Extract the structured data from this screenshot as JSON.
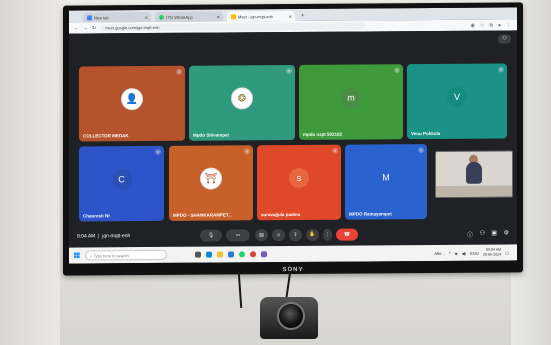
{
  "browser": {
    "tabs": [
      {
        "label": "New tab",
        "icon_color": "#4285f4"
      },
      {
        "label": "(75) WhatsApp",
        "icon_color": "#25d366"
      },
      {
        "label": "Meet - jqn-mqtt-enh",
        "icon_color": "#fbbc04"
      }
    ],
    "url": "meet.google.com/jqn-mqtt-enh"
  },
  "meet": {
    "tiles": [
      {
        "name": "COLLECTOR MEDAK",
        "bg": "#b5532c",
        "initial": ""
      },
      {
        "name": "Mpdo Shivampet",
        "bg": "#2f9a7e",
        "initial": ""
      },
      {
        "name": "mpdo nzpt 502102",
        "bg": "#3e9a3a",
        "initial": "m"
      },
      {
        "name": "Venu Pokkula",
        "bg": "#1a9386",
        "initial": "V"
      },
      {
        "name": "Chauresh Nr",
        "bg": "#2d55c9",
        "initial": "C"
      },
      {
        "name": "MPDO - SHANKARAMPET...",
        "bg": "#c8602a",
        "initial": ""
      },
      {
        "name": "suravajjula padma",
        "bg": "#e0482a",
        "initial": "s"
      },
      {
        "name": "MPDO Ramayampet",
        "bg": "#2a62cf",
        "initial": "M"
      }
    ],
    "time": "9:04 AM",
    "meeting_code": "jqn-mqtt-enh"
  },
  "taskbar": {
    "search_placeholder": "Type here to search",
    "weather": "Afte...",
    "lang": "ENG",
    "time": "09:04 AM",
    "date": "20-06-2024"
  },
  "brand": "SONY",
  "colors": {
    "end_call": "#ea4335",
    "meet_bg": "#202124",
    "control_button": "#3c4043"
  }
}
